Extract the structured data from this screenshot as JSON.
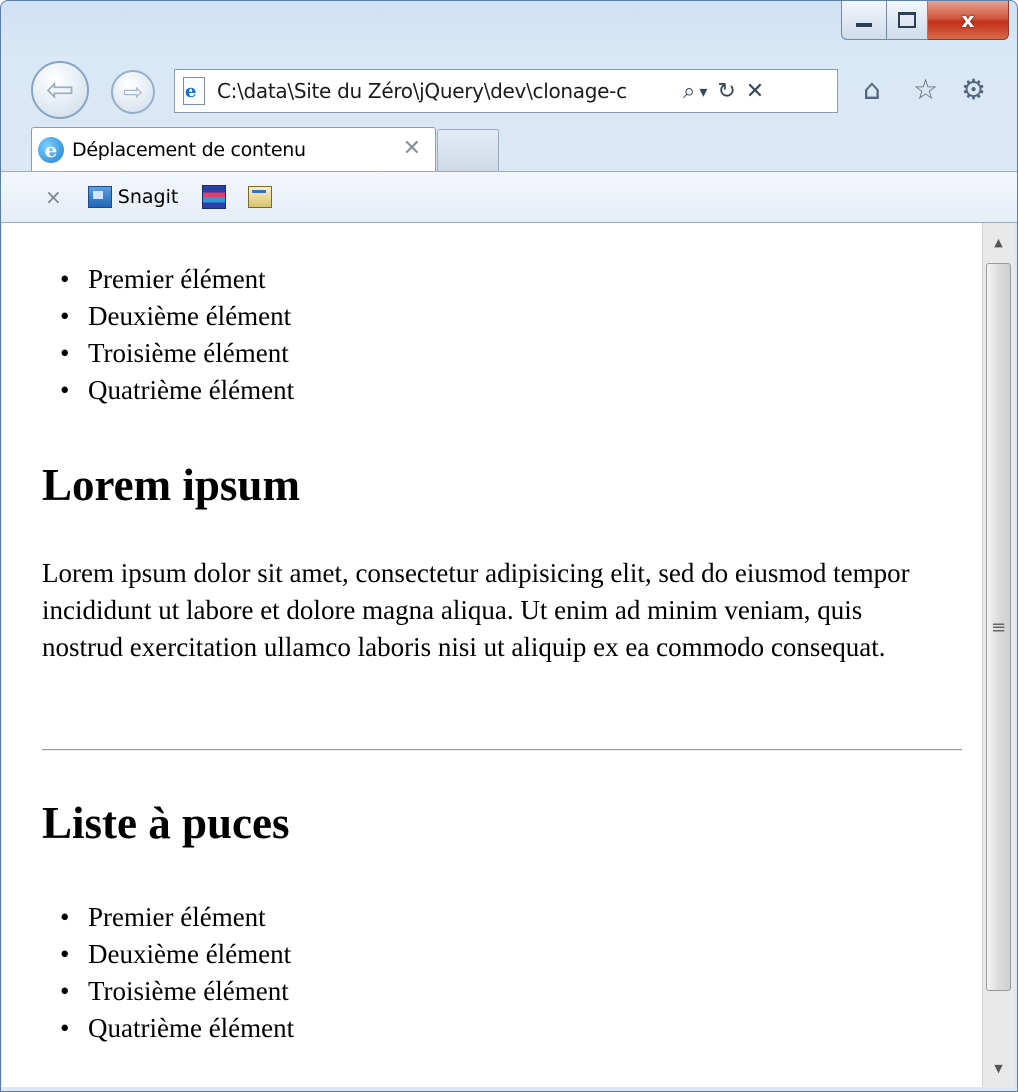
{
  "window": {
    "minimize_icon": "minimize-icon",
    "maximize_icon": "maximize-icon",
    "close_label": "x",
    "close_color": "#c2301b"
  },
  "nav": {
    "back_icon": "back-arrow-icon",
    "back_glyph": "⇦",
    "forward_icon": "forward-arrow-icon",
    "forward_glyph": "⇨",
    "address_value": "C:\\data\\Site du Zéro\\jQuery\\dev\\clonage-c",
    "search_glyph": "⌕",
    "dropdown_glyph": "▾",
    "refresh_glyph": "↻",
    "stop_glyph": "✕",
    "home_glyph": "⌂",
    "favorites_glyph": "☆",
    "tools_glyph": "⚙"
  },
  "tabs": [
    {
      "title": "Déplacement de contenu",
      "close_glyph": "✕"
    }
  ],
  "command_bar": {
    "close_glyph": "×",
    "snagit_label": "Snagit"
  },
  "page": {
    "list_top": [
      "Premier élément",
      "Deuxième élément",
      "Troisième élément",
      "Quatrième élément"
    ],
    "heading1": "Lorem ipsum",
    "paragraph": "Lorem ipsum dolor sit amet, consectetur adipisicing elit, sed do eiusmod tempor incididunt ut labore et dolore magna aliqua. Ut enim ad minim veniam, quis nostrud exercitation ullamco laboris nisi ut aliquip ex ea commodo consequat.",
    "heading2": "Liste à puces",
    "list_bottom": [
      "Premier élément",
      "Deuxième élément",
      "Troisième élément",
      "Quatrième élément"
    ]
  },
  "scrollbar": {
    "up_glyph": "▲",
    "down_glyph": "▼",
    "grip_glyph": "≡"
  }
}
